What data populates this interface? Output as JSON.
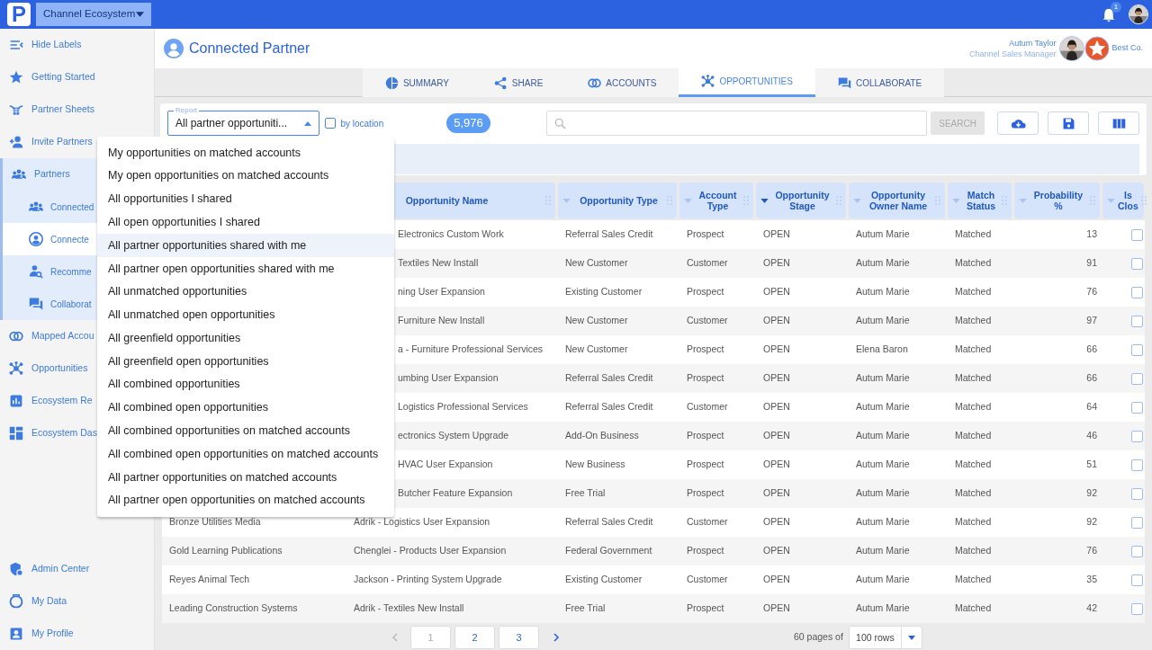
{
  "topbar": {
    "logo": "P",
    "workspace": "Channel Ecosystem",
    "notifications": "1"
  },
  "sidebar": {
    "items": [
      {
        "label": "Hide Labels",
        "selected": false
      },
      {
        "label": "Getting Started",
        "selected": false
      },
      {
        "label": "Partner Sheets",
        "selected": false
      },
      {
        "label": "Invite Partners",
        "selected": false
      },
      {
        "label": "Partners",
        "selected": false,
        "expanded": true,
        "children": [
          {
            "label": "Connected",
            "selected": false
          },
          {
            "label": "Connecte",
            "selected": true
          },
          {
            "label": "Recomme",
            "selected": false
          },
          {
            "label": "Collaborat",
            "selected": false
          }
        ]
      },
      {
        "label": "Mapped Accou",
        "selected": false
      },
      {
        "label": "Opportunities",
        "selected": false
      },
      {
        "label": "Ecosystem Re",
        "selected": false
      },
      {
        "label": "Ecosystem Das",
        "selected": false
      }
    ],
    "bottom": [
      {
        "label": "Admin Center"
      },
      {
        "label": "My Data"
      },
      {
        "label": "My Profile"
      }
    ]
  },
  "page": {
    "title": "Connected Partner",
    "user_name": "Autum Taylor",
    "user_role": "Channel Sales Manager",
    "company": "Best Co."
  },
  "tabs": [
    {
      "label": "SUMMARY",
      "selected": false
    },
    {
      "label": "SHARE",
      "selected": false
    },
    {
      "label": "ACCOUNTS",
      "selected": false
    },
    {
      "label": "OPPORTUNITIES",
      "selected": true
    },
    {
      "label": "COLLABORATE",
      "selected": false
    }
  ],
  "toolbar": {
    "report_label": "Report",
    "report_value": "All partner opportuniti...",
    "by_location": {
      "label": "by location",
      "checked": false
    },
    "count": "5,976",
    "search_button": "SEARCH"
  },
  "report_menu": [
    {
      "label": "My opportunities on matched accounts",
      "selected": false
    },
    {
      "label": "My open opportunities on matched accounts",
      "selected": false
    },
    {
      "label": "All opportunities I shared",
      "selected": false
    },
    {
      "label": "All open opportunities I shared",
      "selected": false
    },
    {
      "label": "All partner opportunities shared with me",
      "selected": true
    },
    {
      "label": "All partner open opportunities shared with me",
      "selected": false
    },
    {
      "label": "All unmatched opportunities",
      "selected": false
    },
    {
      "label": "All unmatched open opportunities",
      "selected": false
    },
    {
      "label": "All greenfield opportunities",
      "selected": false
    },
    {
      "label": "All greenfield open opportunities",
      "selected": false
    },
    {
      "label": "All combined opportunities",
      "selected": false
    },
    {
      "label": "All combined open opportunities",
      "selected": false
    },
    {
      "label": "All combined opportunities on matched accounts",
      "selected": false
    },
    {
      "label": "All combined open opportunities on matched accounts",
      "selected": false
    },
    {
      "label": "All partner opportunities on matched accounts",
      "selected": false
    },
    {
      "label": "All partner open opportunities on matched accounts",
      "selected": false
    }
  ],
  "table": {
    "columns": [
      {
        "label": "Opportunity Name"
      },
      {
        "label": "Opportunity Type",
        "sorted": false
      },
      {
        "label": "Account Type",
        "sorted": false
      },
      {
        "label": "Opportunity Stage",
        "sorted": true
      },
      {
        "label": "Opportunity Owner Name",
        "sorted": false
      },
      {
        "label": "Match Status",
        "sorted": false
      },
      {
        "label": "Probability %",
        "sorted": false
      },
      {
        "label": "Is Clos",
        "sorted": false
      }
    ],
    "rows": [
      {
        "covered": true,
        "opportunity": "Electronics Custom Work",
        "type": "Referral Sales Credit",
        "account_type": "Prospect",
        "stage": "OPEN",
        "owner": "Autum Marie",
        "match": "Matched",
        "probability": "13",
        "closed": false
      },
      {
        "covered": true,
        "opportunity": "Textiles New Install",
        "type": "New Customer",
        "account_type": "Customer",
        "stage": "OPEN",
        "owner": "Autum Marie",
        "match": "Matched",
        "probability": "91",
        "closed": false
      },
      {
        "covered": true,
        "opportunity": "ning User Expansion",
        "type": "Existing Customer",
        "account_type": "Prospect",
        "stage": "OPEN",
        "owner": "Autum Marie",
        "match": "Matched",
        "probability": "76",
        "closed": false
      },
      {
        "covered": true,
        "opportunity": "Furniture New Install",
        "type": "New Customer",
        "account_type": "Customer",
        "stage": "OPEN",
        "owner": "Autum Marie",
        "match": "Matched",
        "probability": "97",
        "closed": false
      },
      {
        "covered": true,
        "opportunity": "a - Furniture Professional Services",
        "type": "New Customer",
        "account_type": "Prospect",
        "stage": "OPEN",
        "owner": "Elena Baron",
        "match": "Matched",
        "probability": "66",
        "closed": false
      },
      {
        "covered": true,
        "opportunity": "umbing User Expansion",
        "type": "Referral Sales Credit",
        "account_type": "Prospect",
        "stage": "OPEN",
        "owner": "Autum Marie",
        "match": "Matched",
        "probability": "66",
        "closed": false
      },
      {
        "covered": true,
        "opportunity": "Logistics Professional Services",
        "type": "Referral Sales Credit",
        "account_type": "Customer",
        "stage": "OPEN",
        "owner": "Autum Marie",
        "match": "Matched",
        "probability": "64",
        "closed": false
      },
      {
        "covered": true,
        "opportunity": "ectronics System Upgrade",
        "type": "Add-On Business",
        "account_type": "Prospect",
        "stage": "OPEN",
        "owner": "Autum Marie",
        "match": "Matched",
        "probability": "46",
        "closed": false
      },
      {
        "covered": true,
        "opportunity": "HVAC User Expansion",
        "type": "New Business",
        "account_type": "Prospect",
        "stage": "OPEN",
        "owner": "Autum Marie",
        "match": "Matched",
        "probability": "51",
        "closed": false
      },
      {
        "covered": true,
        "opportunity": "Butcher Feature Expansion",
        "type": "Free Trial",
        "account_type": "Prospect",
        "stage": "OPEN",
        "owner": "Autum Marie",
        "match": "Matched",
        "probability": "92",
        "closed": false
      },
      {
        "covered": false,
        "account": "Bronze Utilities Media",
        "opportunity": "Adrik - Logistics User Expansion",
        "type": "Referral Sales Credit",
        "account_type": "Customer",
        "stage": "OPEN",
        "owner": "Autum Marie",
        "match": "Matched",
        "probability": "92",
        "closed": false
      },
      {
        "covered": false,
        "account": "Gold Learning Publications",
        "opportunity": "Chenglei - Products User Expansion",
        "type": "Federal Government",
        "account_type": "Prospect",
        "stage": "OPEN",
        "owner": "Autum Marie",
        "match": "Matched",
        "probability": "76",
        "closed": false
      },
      {
        "covered": false,
        "account": "Reyes Animal Tech",
        "opportunity": "Jackson - Printing System Upgrade",
        "type": "Existing Customer",
        "account_type": "Customer",
        "stage": "OPEN",
        "owner": "Autum Marie",
        "match": "Matched",
        "probability": "35",
        "closed": false
      },
      {
        "covered": false,
        "account": "Leading Construction Systems",
        "opportunity": "Adrik - Textiles New Install",
        "type": "Free Trial",
        "account_type": "Prospect",
        "stage": "OPEN",
        "owner": "Autum Marie",
        "match": "Matched",
        "probability": "42",
        "closed": false
      }
    ]
  },
  "pagination": {
    "pages": [
      {
        "label": "1",
        "selected": true
      },
      {
        "label": "2",
        "selected": false
      },
      {
        "label": "3",
        "selected": false
      }
    ],
    "pages_text": "60 pages of",
    "rows_per_page": "100 rows"
  }
}
